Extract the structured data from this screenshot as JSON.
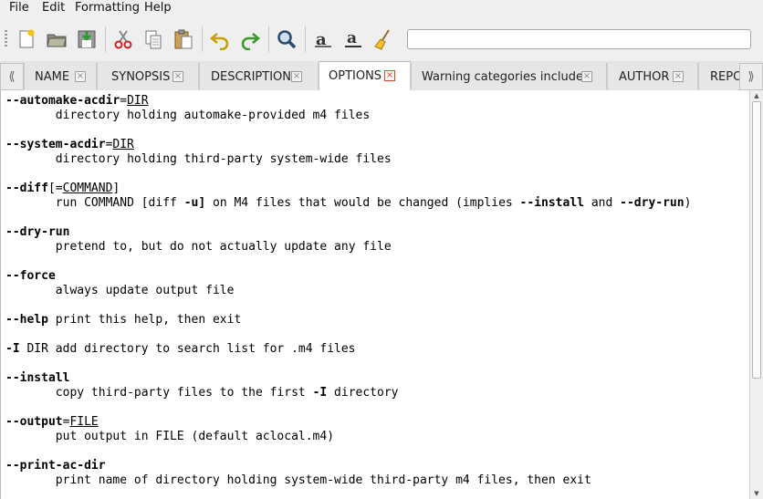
{
  "menu": {
    "file": "File",
    "edit": "Edit",
    "formatting": "Formatting",
    "help": "Help"
  },
  "toolbar": {
    "icons": [
      "new-document-icon",
      "open-folder-icon",
      "save-icon",
      "cut-icon",
      "copy-icon",
      "paste-icon",
      "undo-icon",
      "redo-icon",
      "find-icon",
      "font-icon",
      "underline-font-icon",
      "clear-formatting-icon"
    ],
    "search_value": ""
  },
  "tabs": [
    {
      "label": "NAME",
      "active": false
    },
    {
      "label": "SYNOPSIS",
      "active": false
    },
    {
      "label": "DESCRIPTION",
      "active": false
    },
    {
      "label": "OPTIONS",
      "active": true
    },
    {
      "label": "Warning categories include:",
      "active": false
    },
    {
      "label": "AUTHOR",
      "active": false
    },
    {
      "label": "REPO",
      "active": false
    }
  ],
  "content": {
    "opt1": "--automake-acdir",
    "opt1_arg": "DIR",
    "opt1_desc": "directory holding automake-provided m4 files",
    "opt2": "--system-acdir",
    "opt2_arg": "DIR",
    "opt2_desc": "directory holding third-party system-wide files",
    "opt3": "--diff",
    "opt3_arg": "COMMAND",
    "opt3_desc_a": "run COMMAND [diff ",
    "opt3_desc_u": "-u]",
    "opt3_desc_b": " on M4 files that would be changed (implies ",
    "opt3_desc_install": "--install",
    "opt3_desc_and": " and ",
    "opt3_desc_dry": "--dry-run",
    "opt3_desc_end": ")",
    "opt4": "--dry-run",
    "opt4_desc": "pretend to, but do not actually update any file",
    "opt5": "--force",
    "opt5_desc": "always update output file",
    "opt6": "--help",
    "opt6_desc": " print this help, then exit",
    "opt7": "-I",
    "opt7_desc": " DIR add directory to search list for .m4 files",
    "opt8": "--install",
    "opt8_desc_a": "copy third-party files to the first ",
    "opt8_desc_i": "-I",
    "opt8_desc_b": " directory",
    "opt9": "--output",
    "opt9_arg": "FILE",
    "opt9_desc": "put output in FILE (default aclocal.m4)",
    "opt10": "--print-ac-dir",
    "opt10_desc": "print name of directory holding system-wide third-party m4 files, then exit"
  }
}
